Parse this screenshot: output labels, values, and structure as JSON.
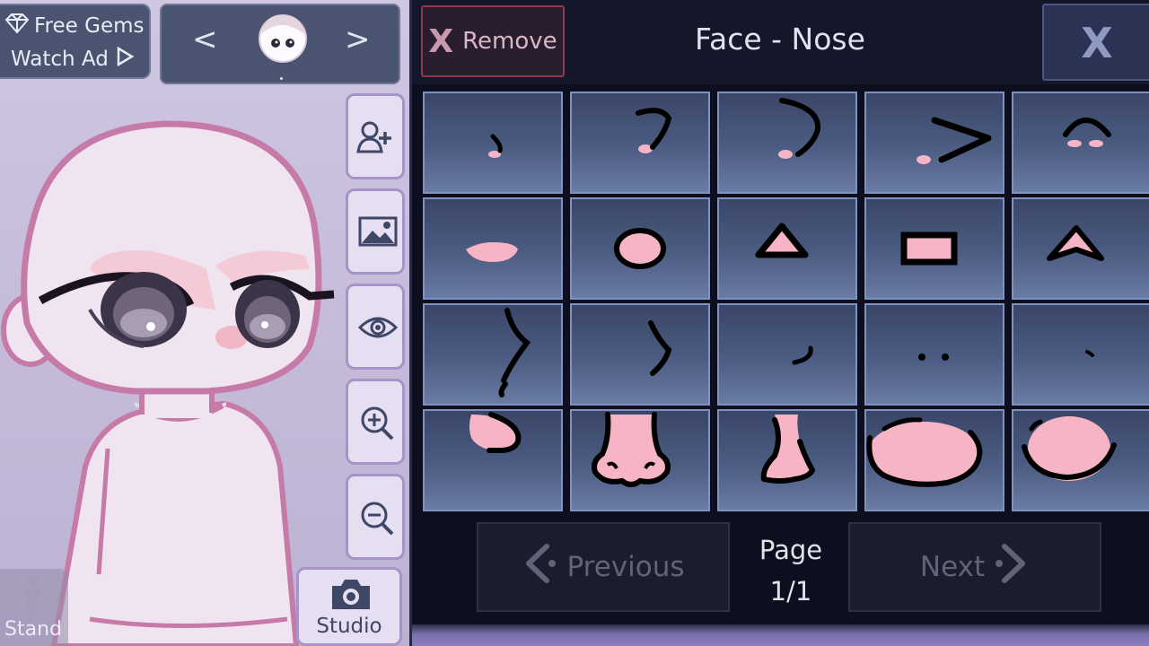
{
  "top_left": {
    "free_gems_label": "Free Gems",
    "watch_ad_label": "Watch Ad",
    "gem_icon": "diamond-icon",
    "play_icon": "play-triangle-icon"
  },
  "character_switcher": {
    "prev_glyph": "<",
    "next_glyph": ">"
  },
  "side_tools": [
    {
      "name": "add-character-icon"
    },
    {
      "name": "background-image-icon"
    },
    {
      "name": "eye-icon"
    },
    {
      "name": "zoom-in-icon"
    },
    {
      "name": "zoom-out-icon"
    }
  ],
  "bottom_left": {
    "stand_label": "Stand",
    "studio_label": "Studio"
  },
  "panel": {
    "remove_x": "X",
    "remove_label": "Remove",
    "title": "Face - Nose",
    "close_glyph": "X",
    "nose_options": [
      {
        "style": "dot-curve"
      },
      {
        "style": "hook"
      },
      {
        "style": "long-curve"
      },
      {
        "style": "chevron"
      },
      {
        "style": "arch"
      },
      {
        "style": "pink-oval"
      },
      {
        "style": "circle"
      },
      {
        "style": "triangle"
      },
      {
        "style": "rectangle"
      },
      {
        "style": "arrow"
      },
      {
        "style": "s-curve"
      },
      {
        "style": "short-s"
      },
      {
        "style": "small-hook"
      },
      {
        "style": "two-dots"
      },
      {
        "style": "single-dot"
      },
      {
        "style": "round-bulb"
      },
      {
        "style": "full-nose"
      },
      {
        "style": "side-nose"
      },
      {
        "style": "wide-oval"
      },
      {
        "style": "half-oval"
      }
    ],
    "pagination": {
      "previous_label": "Previous",
      "next_label": "Next",
      "page_word": "Page",
      "page_value": "1/1"
    }
  },
  "colors": {
    "skin": "#efe4f0",
    "outline": "#c67aa8",
    "nose_pink": "#f6b4c4",
    "panel_bg": "#0d0f1e",
    "cell_border": "#7f92c0"
  }
}
